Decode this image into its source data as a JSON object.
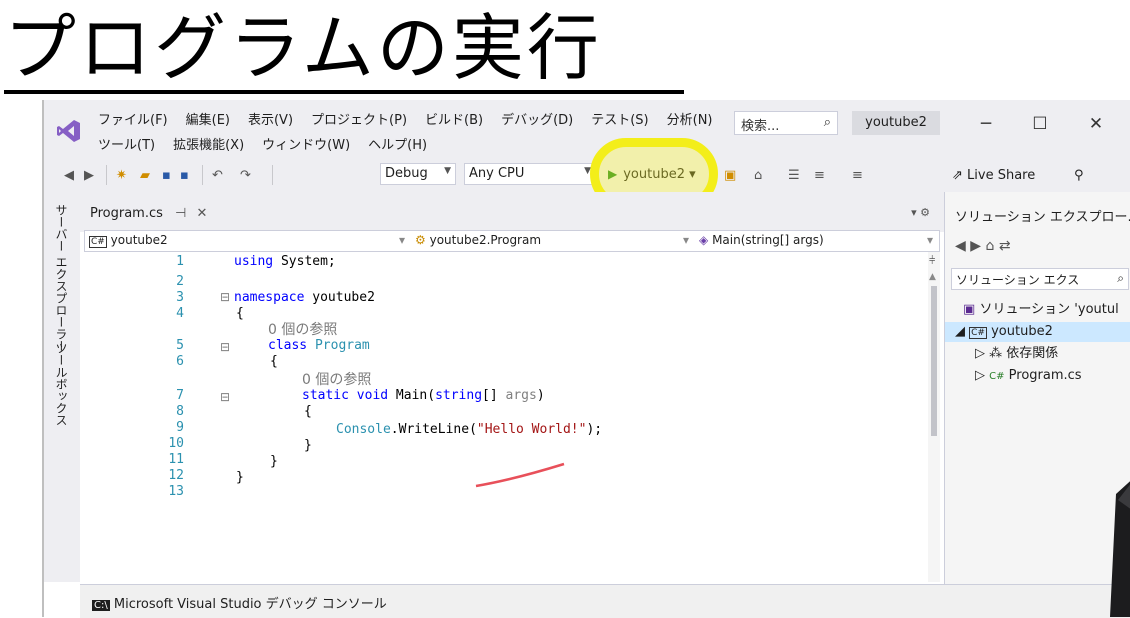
{
  "heading": {
    "title": "プログラムの実行"
  },
  "menubar": {
    "row1": [
      "ファイル(F)",
      "編集(E)",
      "表示(V)",
      "プロジェクト(P)",
      "ビルド(B)",
      "デバッグ(D)",
      "テスト(S)",
      "分析(N)"
    ],
    "row2": [
      "ツール(T)",
      "拡張機能(X)",
      "ウィンドウ(W)",
      "ヘルプ(H)"
    ],
    "search_label": "検索...",
    "solution_name": "youtube2"
  },
  "toolbar": {
    "config": "Debug",
    "platform": "Any CPU",
    "run_label": "youtube2",
    "live_share": "Live Share"
  },
  "left_tabs": [
    "サーバー エクスプローラー",
    "ツールボックス"
  ],
  "editor": {
    "tab_label": "Program.cs",
    "nav_project": "youtube2",
    "nav_class": "youtube2.Program",
    "nav_member": "Main(string[] args)",
    "line_numbers": [
      "1",
      "2",
      "3",
      "4",
      "5",
      "6",
      "7",
      "8",
      "9",
      "10",
      "11",
      "12",
      "13"
    ],
    "hint_refs": "0 個の参照",
    "code": {
      "using_kw": "using",
      "using_rest": " System;",
      "namespace_kw": "namespace",
      "namespace_name": " youtube2",
      "open_brace": "{",
      "close_brace": "}",
      "class_kw": "class",
      "class_name": "Program",
      "static_void": "static void",
      "main_sig": " Main(",
      "string_kw": "string",
      "args_rest": "[] ",
      "args_name": "args",
      "close_paren": ")",
      "console": "Console",
      "writeline": ".WriteLine(",
      "hello": "\"Hello World!\"",
      "end_stmt": ");"
    }
  },
  "solution_explorer": {
    "title": "ソリューション エクスプロー...",
    "search_placeholder": "ソリューション エクス",
    "items": [
      "ソリューション 'youtul",
      "youtube2",
      "依存関係",
      "Program.cs"
    ]
  },
  "bottom": {
    "console_title": "Microsoft Visual Studio デバッグ コンソール"
  }
}
